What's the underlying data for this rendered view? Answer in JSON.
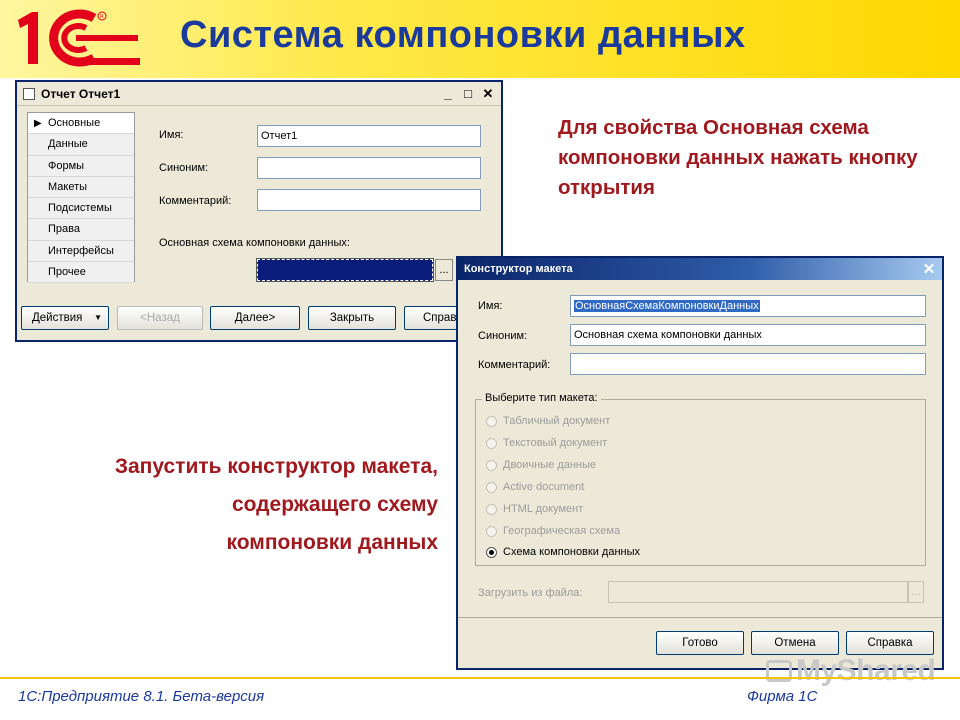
{
  "slide": {
    "title": "Система компоновки данных",
    "footer_left": "1С:Предприятие 8.1. Бета-версия",
    "footer_right": "Фирма 1С",
    "watermark": "MyShared"
  },
  "colors": {
    "title": "#1a3a9c",
    "note": "#a0191e",
    "header_yellow": "#ffd800",
    "logo_red": "#e2001a"
  },
  "notes": {
    "top": "Для свойства Основная схема компоновки данных нажать кнопку открытия",
    "bottom_line1": "Запустить конструктор макета,",
    "bottom_line2": "содержащего схему",
    "bottom_line3": "компоновки данных"
  },
  "report_window": {
    "title": "Отчет Отчет1",
    "nav_items": [
      "Основные",
      "Данные",
      "Формы",
      "Макеты",
      "Подсистемы",
      "Права",
      "Интерфейсы",
      "Прочее"
    ],
    "active_nav": "Основные",
    "labels": {
      "name": "Имя:",
      "synonym": "Синоним:",
      "comment": "Комментарий:",
      "main_schema": "Основная схема компоновки данных:"
    },
    "values": {
      "name": "Отчет1",
      "synonym": "",
      "comment": "",
      "main_schema": ""
    },
    "open_button": "...",
    "buttons": {
      "actions": "Действия",
      "back": "<Назад",
      "next": "Далее>",
      "close": "Закрыть",
      "help": "Справка"
    }
  },
  "constructor_window": {
    "title": "Конструктор макета",
    "labels": {
      "name": "Имя:",
      "synonym": "Синоним:",
      "comment": "Комментарий:",
      "group": "Выберите тип макета:",
      "load": "Загрузить из файла:"
    },
    "values": {
      "name": "ОсновнаяСхемаКомпоновкиДанных",
      "synonym": "Основная схема компоновки данных",
      "comment": "",
      "load": ""
    },
    "template_types": [
      "Табличный документ",
      "Текстовый документ",
      "Двоичные данные",
      "Active document",
      "HTML документ",
      "Географическая схема",
      "Схема компоновки данных"
    ],
    "selected_type": "Схема компоновки данных",
    "buttons": {
      "done": "Готово",
      "cancel": "Отмена",
      "help": "Справка",
      "browse": "..."
    }
  }
}
